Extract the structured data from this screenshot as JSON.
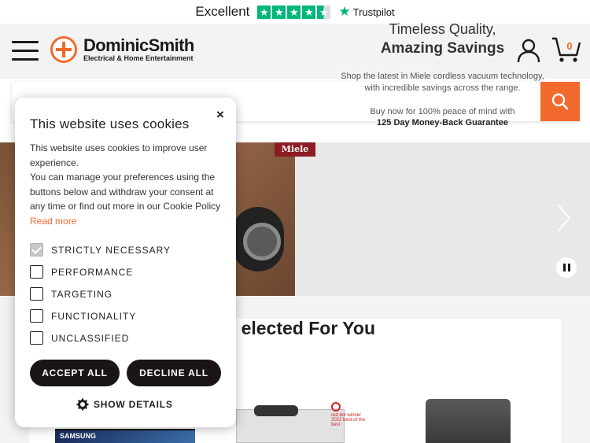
{
  "trustpilot": {
    "label": "Excellent",
    "rating_stars": 4.5,
    "brand": "Trustpilot",
    "color": "#00b67a"
  },
  "header": {
    "logo_name": "DominicSmith",
    "logo_tagline": "Electrical & Home Entertainment",
    "cart_count": "0",
    "accent_color": "#f26a2e"
  },
  "search": {
    "value": "",
    "placeholder": ""
  },
  "hero": {
    "brand": "Miele",
    "headline_1": "Timeless Quality,",
    "headline_2": "Amazing Savings",
    "body_1": "Shop the latest in Miele cordless vacuum technology,",
    "body_2": "with incredible savings across the range.",
    "cta_1": "Buy now for 100% peace of mind with",
    "cta_2": "125 Day Money-Back Guarantee"
  },
  "section": {
    "title": "elected For You",
    "products": [
      {
        "label": "SAMSUNG"
      },
      {
        "label": "red dot winner 2022 best of the best"
      },
      {
        "label": ""
      }
    ]
  },
  "cookie": {
    "title": "This website uses cookies",
    "text_1": "This website uses cookies to improve user experience.",
    "text_2": "You can manage your preferences using the buttons below and withdraw your consent at any time or find out more in our Cookie Policy",
    "read_more": "Read more",
    "close_symbol": "×",
    "options": [
      {
        "label": "STRICTLY NECESSARY",
        "checked": true
      },
      {
        "label": "PERFORMANCE",
        "checked": false
      },
      {
        "label": "TARGETING",
        "checked": false
      },
      {
        "label": "FUNCTIONALITY",
        "checked": false
      },
      {
        "label": "UNCLASSIFIED",
        "checked": false
      }
    ],
    "accept_label": "ACCEPT ALL",
    "decline_label": "DECLINE ALL",
    "details_label": "SHOW DETAILS"
  }
}
